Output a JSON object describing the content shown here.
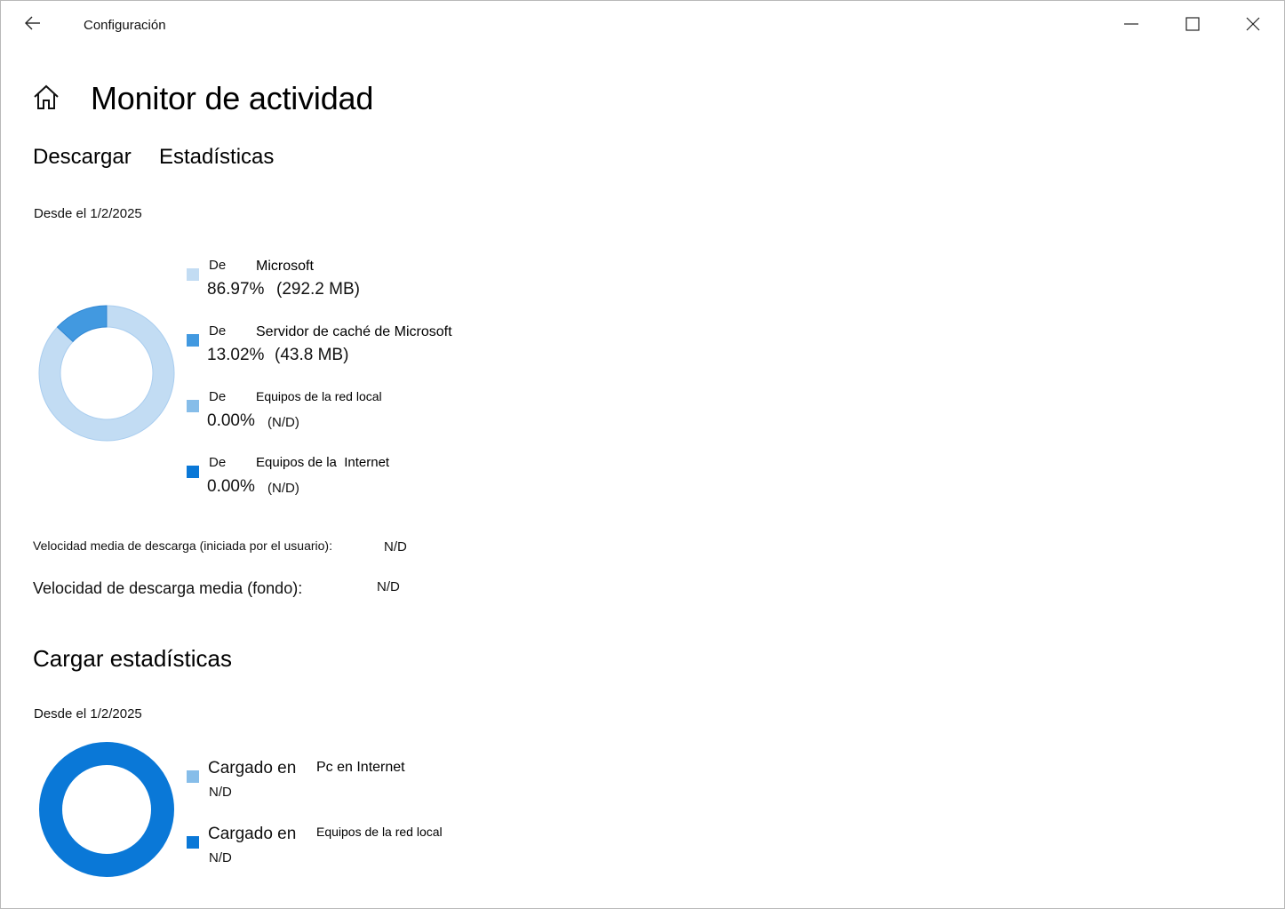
{
  "window": {
    "title": "Configuración",
    "controls": {
      "minimize": "minimize-icon",
      "maximize": "maximize-icon",
      "close": "close-icon"
    }
  },
  "header": {
    "title": "Monitor de actividad",
    "home_icon": "home-icon"
  },
  "tabs": [
    {
      "label": "Descargar"
    },
    {
      "label": "Estadísticas"
    }
  ],
  "download": {
    "since": "Desde el 1/2/2025",
    "sources": [
      {
        "prefix": "De",
        "name": "Microsoft",
        "percent": "86.97%",
        "size": "(292.2 MB)",
        "color": "#c2dcf3",
        "fraction": 0.8697
      },
      {
        "prefix": "De",
        "name": "Servidor de caché de Microsoft",
        "percent": "13.02%",
        "size": "(43.8 MB)",
        "color": "#4299e0",
        "fraction": 0.1302
      },
      {
        "prefix": "De",
        "name": "Equipos de la red local",
        "percent": "0.00%",
        "size": "(N/D)",
        "color": "#86bde9",
        "fraction": 0
      },
      {
        "prefix": "De",
        "name": "Equipos de la  Internet",
        "percent": "0.00%",
        "size": "(N/D)",
        "color": "#0a78d7",
        "fraction": 0
      }
    ],
    "avg_user_label": "Velocidad media de descarga (iniciada por el usuario):",
    "avg_user_value": "N/D",
    "avg_bg_label": "Velocidad de descarga media (fondo):",
    "avg_bg_value": "N/D"
  },
  "upload": {
    "title": "Cargar estadísticas",
    "since": "Desde el 1/2/2025",
    "targets": [
      {
        "prefix": "Cargado en",
        "name": "Pc en Internet",
        "value": "N/D",
        "color": "#86bde9"
      },
      {
        "prefix": "Cargado en",
        "name": "Equipos de la red local",
        "value": "N/D",
        "color": "#0a78d7"
      }
    ],
    "donut_color": "#0a78d7"
  }
}
